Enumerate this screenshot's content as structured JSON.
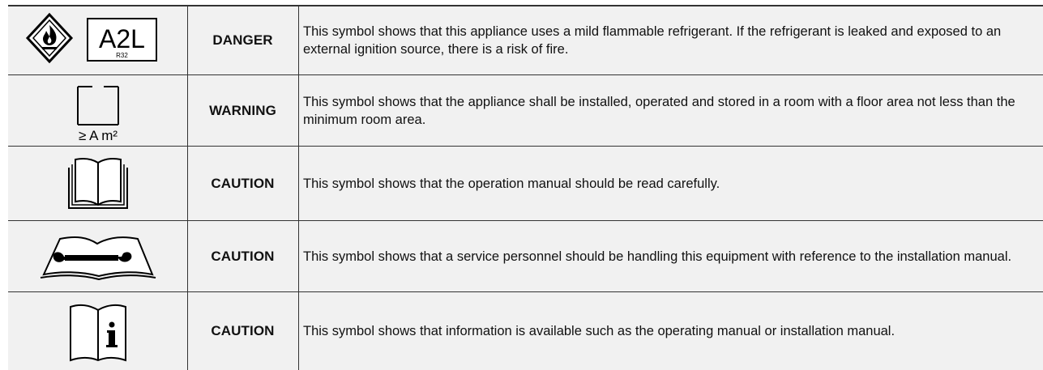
{
  "rows": [
    {
      "level": "DANGER",
      "icon": "flammable-refrigerant-icon",
      "icon_text": "A2L",
      "icon_subtext": "R32",
      "text": "This symbol shows that this appliance uses a mild flammable refrigerant. If the refrigerant is leaked and exposed to an external ignition source, there is a risk of fire."
    },
    {
      "level": "WARNING",
      "icon": "minimum-room-area-icon",
      "icon_text": "≥ A m²",
      "text": "This symbol shows that the appliance shall be installed, operated and stored in a room with a floor area not less than the minimum room area."
    },
    {
      "level": "CAUTION",
      "icon": "operation-manual-icon",
      "text": "This symbol shows that the operation manual should be read carefully."
    },
    {
      "level": "CAUTION",
      "icon": "service-manual-wrench-icon",
      "text": "This symbol shows that a service personnel should be handling this equipment with reference to the installation manual."
    },
    {
      "level": "CAUTION",
      "icon": "information-manual-icon",
      "text": "This symbol shows that information is available such as the operating manual or installation manual."
    }
  ]
}
